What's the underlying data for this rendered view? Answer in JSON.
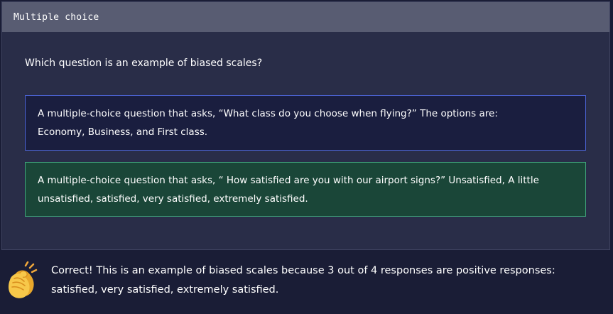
{
  "card": {
    "header_label": "Multiple choice",
    "question": "Which question is an example of biased scales?",
    "options": [
      {
        "text": "A multiple-choice question that asks, “What class do you choose when flying?” The options are: Economy, Business, and First class.",
        "state": "unselected"
      },
      {
        "text": "A multiple-choice question that asks, “ How satisfied are you with our airport signs?” Unsatisfied, A little unsatisfied, satisfied, very satisfied, extremely satisfied.",
        "state": "correct"
      }
    ]
  },
  "feedback": {
    "icon": "clapping-hands-icon",
    "text": "Correct! This is an example of biased scales because 3 out of 4 responses are positive responses: satisfied, very satisfied, extremely satisfied."
  },
  "colors": {
    "page_background": "#1a1d36",
    "card_background": "#292d48",
    "header_background": "#585c72",
    "option_default_border": "#4b63d4",
    "option_correct_background": "#1a4638",
    "option_correct_border": "#3fa37a"
  }
}
